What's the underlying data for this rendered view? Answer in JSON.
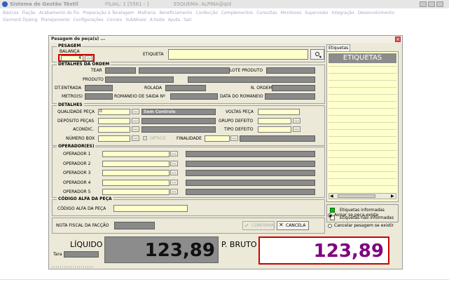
{
  "titlebar": {
    "title": "Sistema de Gestão Têxtil",
    "filial": "FILIAL: 1 [5561 - ]",
    "esquema": "ESQUEMA: ALPINA@qld"
  },
  "menu": {
    "row1": [
      "Básicos",
      "Fiação",
      "Acabamento do Fio",
      "Preparação à Tecelagem",
      "Malharia",
      "Beneficiamento",
      "Confecção",
      "Complementos",
      "Consultas",
      "Monitores",
      "Supervisão",
      "Integração",
      "Desenvolvimento"
    ],
    "row2": [
      "Garment Dyeing",
      "Planejamento",
      "Configurações",
      "Correio",
      "SubNíveis",
      "A toste",
      "Ajuda",
      "Sair"
    ]
  },
  "dialog": {
    "title": "Pesagem de peça(s) ...",
    "pesagem": {
      "title": "PESAGEM",
      "balanca_label": "BALANÇA",
      "balanca_value": "4",
      "etiqueta_label": "ETIQUETA"
    },
    "ordem": {
      "title": "DETALHES DA ORDEM",
      "tear": "TEAR",
      "lote_produto": "LOTE PRODUTO",
      "produto": "PRODUTO",
      "dt_entrada": "DT.ENTRADA",
      "rolada": "ROLADA",
      "n_ordem": "N. ORDEM",
      "metros": "METRO(S)",
      "romaneio_saida": "ROMANEIO DE SAIDA Nº",
      "data_romaneio": "DATA DO ROMANEIO"
    },
    "detalhes": {
      "title": "DETALHES",
      "qualidade": "QUALIDADE PEÇA",
      "qualidade_value": "0",
      "sem_controle": "Sem Controle",
      "voltas": "VOLTAS PEÇA",
      "deposito": "DEPÓSITO PEÇAS",
      "grupo_defeito": "GRUPO DEFEITO",
      "acondic": "ACONDIC.",
      "tipo_defeito": "TIPO DEFEITO",
      "numero_box": "NÚMERO BOX",
      "optico": "OPTICO",
      "finalidade": "FINALIDADE"
    },
    "operadores": {
      "title": "OPERADOR(ES)",
      "items": [
        "OPERADOR 1",
        "OPERADOR 2",
        "OPERADOR 3",
        "OPERADOR 4",
        "OPERADOR 5"
      ]
    },
    "codigo": {
      "title": "CÓDIGO ALFA DA PEÇA",
      "label": "CÓDIGO ALFA DA PEÇA"
    },
    "nota_fiscal": "NOTA FISCAL DA FACÇÃO",
    "confirma": "CONFIRMA",
    "cancela": "CANCELA",
    "liquido_label": "LÍQUIDO",
    "liquido_value": "123,89",
    "tara_label": "Tara",
    "bruto_label": "P. BRUTO",
    "bruto_value": "123,89",
    "etiquetas_tab": "Etiquetas",
    "etiquetas_header": "ETIQUETAS",
    "legend_informadas": "Etiquetas informadas",
    "legend_nao": "Etiquetas não informadas",
    "radio_avisar": "Avisar se peça existe",
    "radio_cancelar": "Cancelar pesagem se existir"
  },
  "colors": {
    "brand_purple": "#800080",
    "title_blue": "#0a246a",
    "field_yellow": "#ffffcc",
    "field_gray": "#8a8a8a",
    "alert_red": "#cc0000",
    "legend_green": "#00c000"
  }
}
